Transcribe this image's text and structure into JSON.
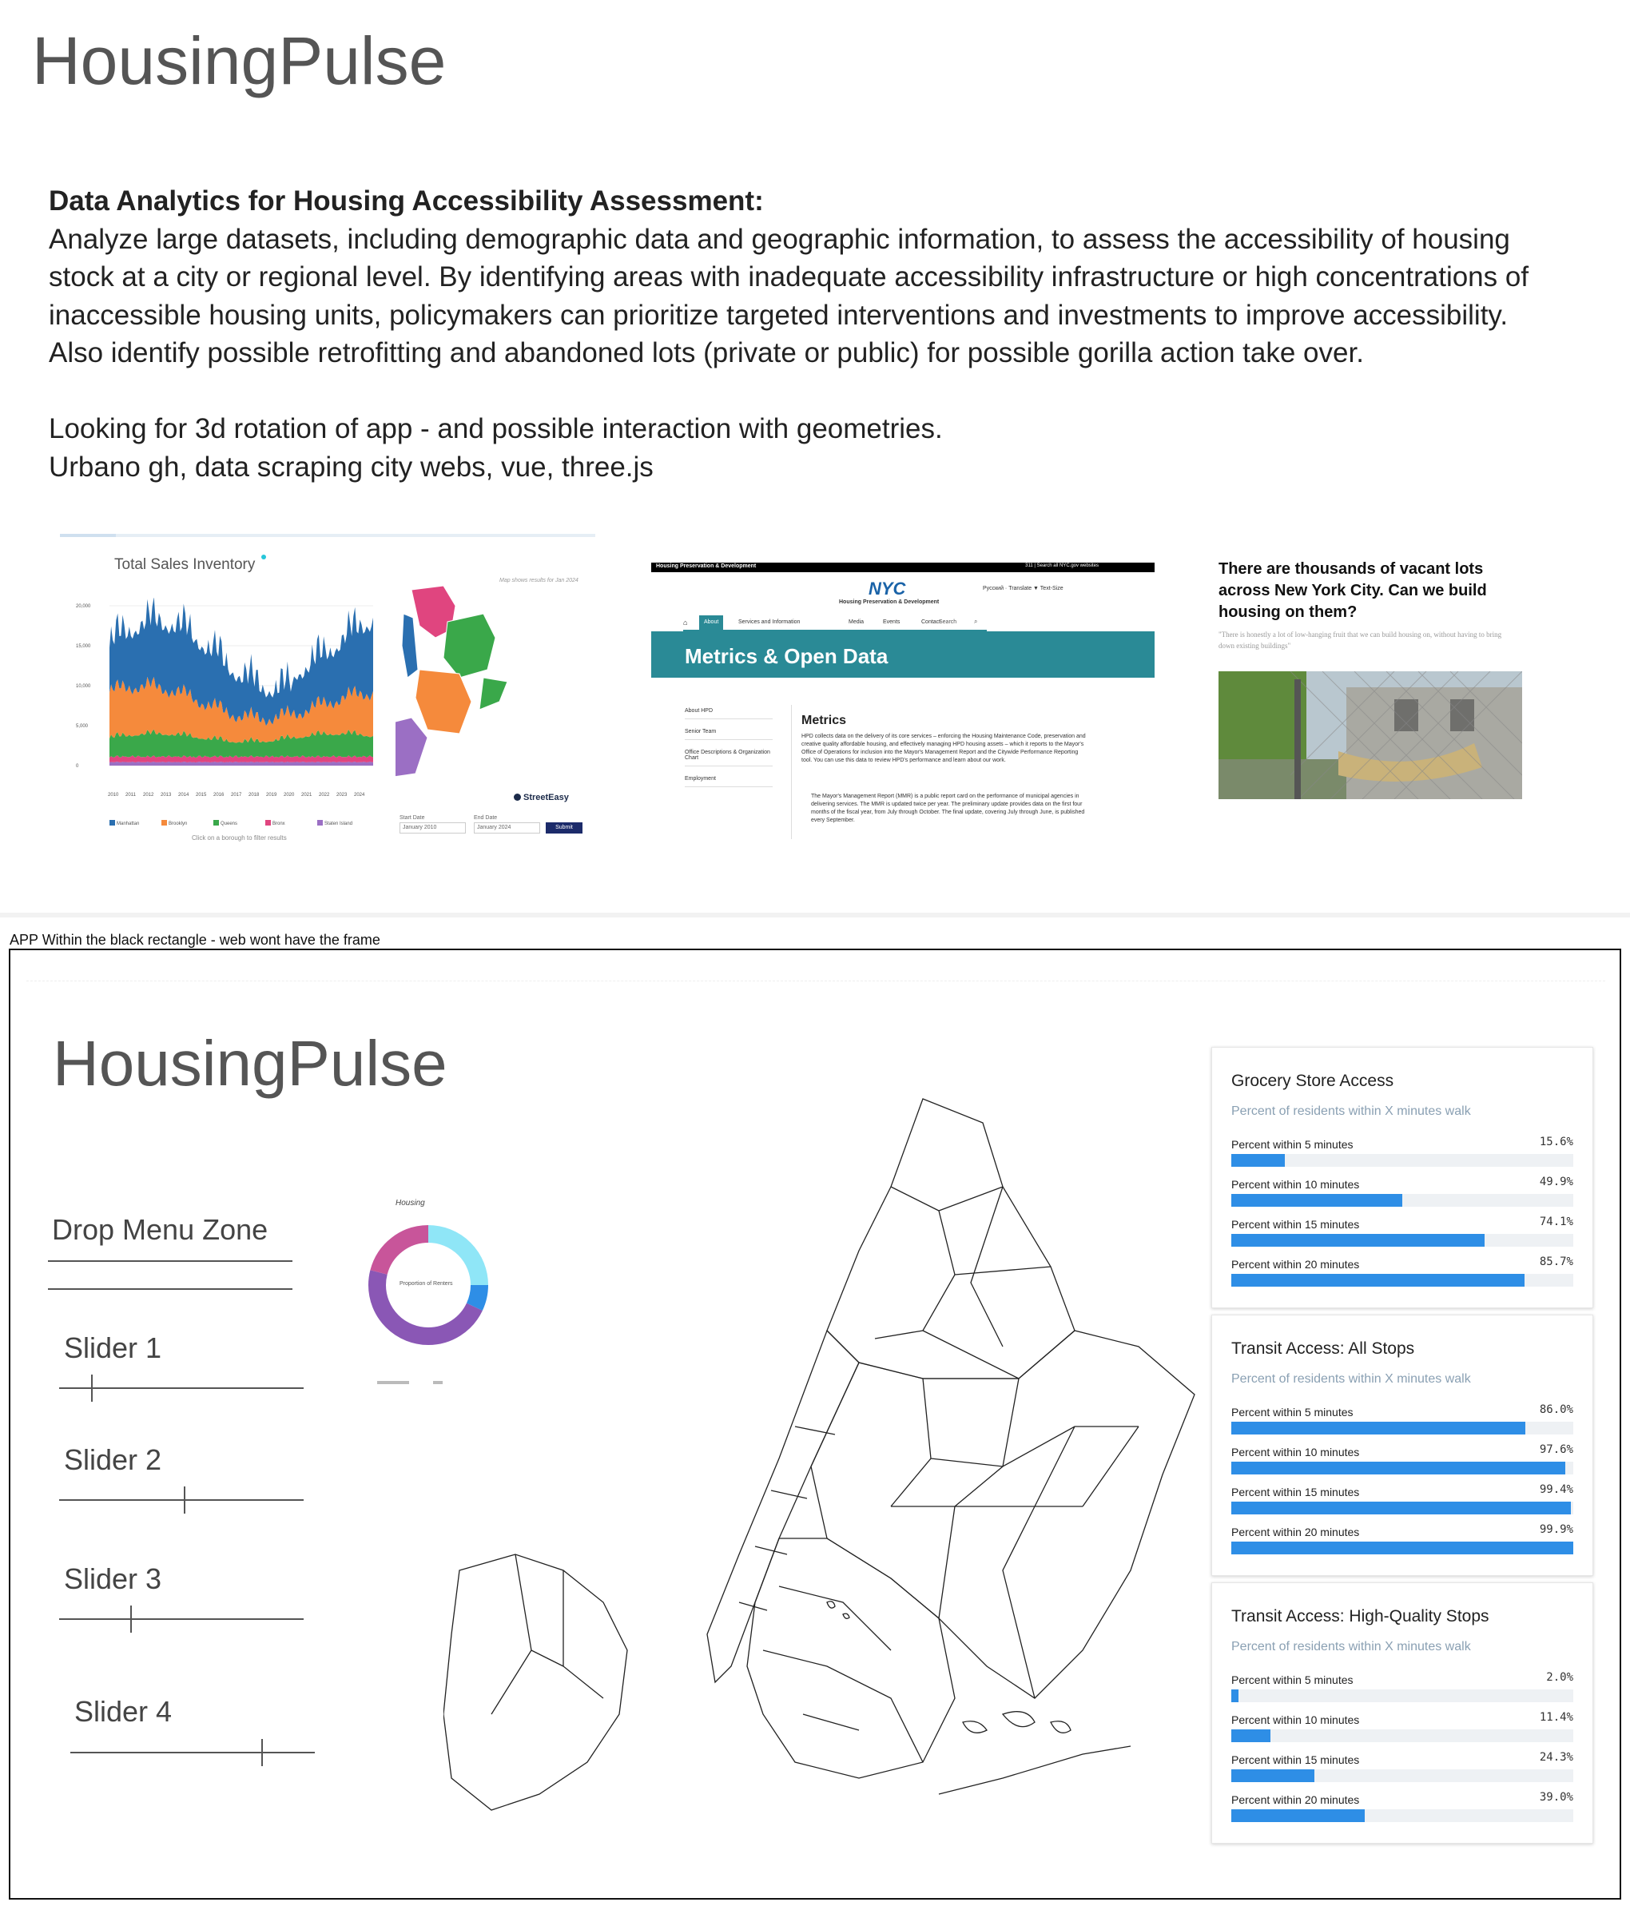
{
  "header": {
    "title": "HousingPulse"
  },
  "description": {
    "heading": "Data Analytics for Housing Accessibility Assessment:",
    "line1": "Analyze large datasets, including demographic data and geographic information, to assess the accessibility of housing",
    "line2": "stock at a city or regional level. By identifying areas with inadequate accessibility infrastructure or high concentrations of",
    "line3": "inaccessible housing units, policymakers can prioritize targeted interventions and investments to improve accessibility.",
    "line4": "Also identify possible retrofitting and abandoned lots (private or public) for possible gorilla action take over.",
    "line5": "Looking for 3d rotation of app - and possible interaction with geometries.",
    "line6": "Urbano gh, data scraping city webs, vue, three.js"
  },
  "reference1": {
    "title": "Total Sales Inventory",
    "yticks": [
      "20,000",
      "15,000",
      "10,000",
      "5,000",
      "0"
    ],
    "xticks": [
      "2010",
      "2011",
      "2012",
      "2013",
      "2014",
      "2015",
      "2016",
      "2017",
      "2018",
      "2019",
      "2020",
      "2021",
      "2022",
      "2023",
      "2024"
    ],
    "legend": [
      {
        "label": "Manhattan",
        "color": "#2a6fb0"
      },
      {
        "label": "Brooklyn",
        "color": "#f58a3c"
      },
      {
        "label": "Queens",
        "color": "#3aa84a"
      },
      {
        "label": "Bronx",
        "color": "#e0457f"
      },
      {
        "label": "Staten Island",
        "color": "#9b6fc4"
      }
    ],
    "note": "Click on a borough to filter results",
    "map_note": "Map shows results for Jan 2024",
    "brand": "StreetEasy",
    "start_label": "Start Date",
    "start_value": "January 2010",
    "end_label": "End Date",
    "end_value": "January 2024",
    "submit": "Submit"
  },
  "reference2": {
    "topbar_left": "Housing Preservation & Development",
    "topbar_right": "311 | Search all NYC.gov websites",
    "logo": "NYC",
    "agency": "Housing Preservation & Development",
    "translate": "Русский · Translate ▼    Text-Size",
    "nav": [
      "About",
      "Services and Information",
      "Media",
      "Events",
      "Contact"
    ],
    "search": "Search",
    "banner": "Metrics & Open Data",
    "side": [
      "About HPD",
      "Senior Team",
      "Office Descriptions & Organization Chart",
      "Employment"
    ],
    "heading": "Metrics",
    "body": "HPD collects data on the delivery of its core services – enforcing the Housing Maintenance Code, preservation and creative quality affordable housing, and effectively managing HPD housing assets – which it reports to the Mayor's Office of Operations for inclusion into the Mayor's Management Report and the Citywide Performance Reporting tool. You can use this data to review HPD's performance and learn about our work.",
    "bullet": "The Mayor's Management Report (MMR) is a public report card on the performance of municipal agencies in delivering services. The MMR is updated twice per year. The preliminary update provides data on the first four months of the fiscal year, from July through October. The final update, covering July through June, is published every September."
  },
  "reference3": {
    "headline": "There are thousands of vacant lots across New York City. Can we build housing on them?",
    "quote": "\"There is honestly a lot of low-hanging fruit that we can build housing on, without having to bring down existing buildings\""
  },
  "app": {
    "frame_note": "APP Within the black rectangle - web wont have the frame",
    "title": "HousingPulse",
    "dropdown_label": "Drop Menu Zone",
    "donut_title": "Housing",
    "donut_center": "Proportion of Renters",
    "sliders": [
      {
        "label": "Slider 1",
        "value": 0.13
      },
      {
        "label": "Slider 2",
        "value": 0.51
      },
      {
        "label": "Slider 3",
        "value": 0.29
      },
      {
        "label": "Slider 4",
        "value": 0.78
      }
    ],
    "donut_segments": [
      {
        "value": 0.25,
        "color": "#8fe6f7"
      },
      {
        "value": 0.07,
        "color": "#2e8ee6"
      },
      {
        "value": 0.47,
        "color": "#8a57b5"
      },
      {
        "value": 0.21,
        "color": "#c8559a"
      }
    ],
    "panels": [
      {
        "title": "Grocery Store Access",
        "subtitle": "Percent of residents within X minutes walk",
        "rows": [
          {
            "label": "Percent within 5 minutes",
            "value": "15.6%",
            "pct": 15.6
          },
          {
            "label": "Percent within 10 minutes",
            "value": "49.9%",
            "pct": 49.9
          },
          {
            "label": "Percent within 15 minutes",
            "value": "74.1%",
            "pct": 74.1
          },
          {
            "label": "Percent within 20 minutes",
            "value": "85.7%",
            "pct": 85.7
          }
        ]
      },
      {
        "title": "Transit Access: All Stops",
        "subtitle": "Percent of residents within X minutes walk",
        "rows": [
          {
            "label": "Percent within 5 minutes",
            "value": "86.0%",
            "pct": 86.0
          },
          {
            "label": "Percent within 10 minutes",
            "value": "97.6%",
            "pct": 97.6
          },
          {
            "label": "Percent within 15 minutes",
            "value": "99.4%",
            "pct": 99.4
          },
          {
            "label": "Percent within 20 minutes",
            "value": "99.9%",
            "pct": 99.9
          }
        ]
      },
      {
        "title": "Transit Access: High-Quality Stops",
        "subtitle": "Percent of residents within X minutes walk",
        "rows": [
          {
            "label": "Percent within 5 minutes",
            "value": "2.0%",
            "pct": 2.0
          },
          {
            "label": "Percent within 10 minutes",
            "value": "11.4%",
            "pct": 11.4
          },
          {
            "label": "Percent within 15 minutes",
            "value": "24.3%",
            "pct": 24.3
          },
          {
            "label": "Percent within 20 minutes",
            "value": "39.0%",
            "pct": 39.0
          }
        ]
      }
    ]
  }
}
